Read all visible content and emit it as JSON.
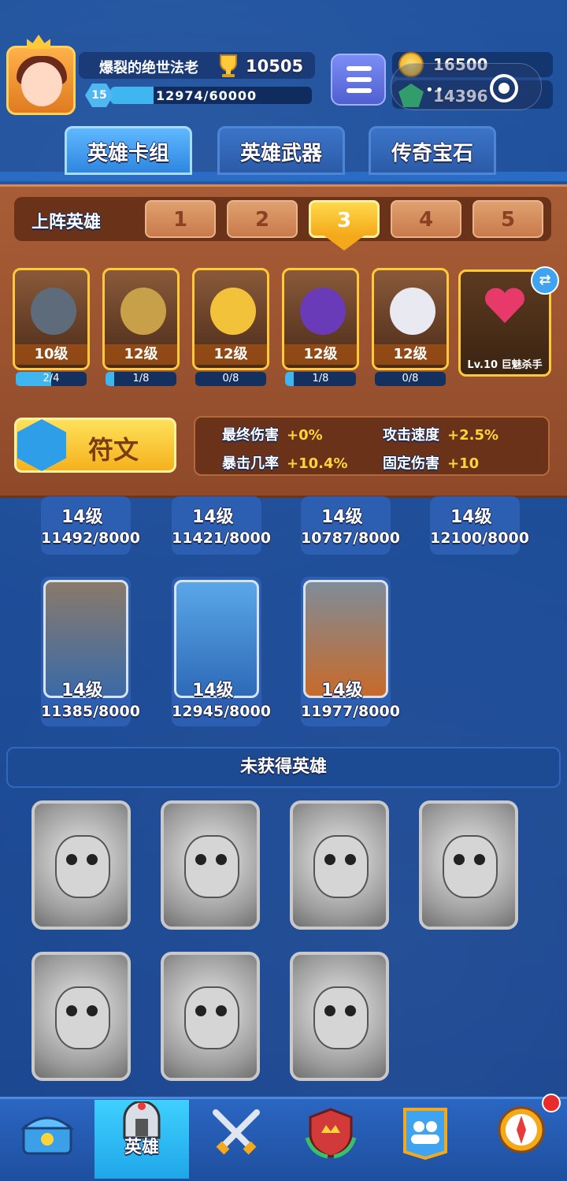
{
  "header": {
    "player_name": "爆裂的绝世法老",
    "trophies": "10505",
    "level": "15",
    "xp_text": "12974/60000",
    "xp_fraction": 0.216,
    "coins": "16500",
    "gems": "14396"
  },
  "tabs": [
    {
      "label": "英雄卡组",
      "active": true
    },
    {
      "label": "英雄武器",
      "active": false
    },
    {
      "label": "传奇宝石",
      "active": false
    }
  ],
  "deck": {
    "slots_label": "上阵英雄",
    "slots": [
      "1",
      "2",
      "3",
      "4",
      "5"
    ],
    "active_slot": "3",
    "heroes": [
      {
        "level": "10级",
        "progress": "2/4",
        "fraction": 0.5,
        "color": "#5d6b7a"
      },
      {
        "level": "12级",
        "progress": "1/8",
        "fraction": 0.125,
        "color": "#c9a04a"
      },
      {
        "level": "12级",
        "progress": "0/8",
        "fraction": 0,
        "color": "#f2c23a"
      },
      {
        "level": "12级",
        "progress": "1/8",
        "fraction": 0.125,
        "color": "#6a3bb8"
      },
      {
        "level": "12级",
        "progress": "0/8",
        "fraction": 0,
        "color": "#e9e9f2"
      }
    ],
    "special": {
      "label": "Lv.10 巨魅杀手"
    },
    "rune_label": "符文",
    "stats": [
      {
        "key": "最终伤害",
        "value": "+0%"
      },
      {
        "key": "攻击速度",
        "value": "+2.5%"
      },
      {
        "key": "暴击几率",
        "value": "+10.4%"
      },
      {
        "key": "固定伤害",
        "value": "+10"
      }
    ]
  },
  "owned": {
    "row1": [
      {
        "level": "14级",
        "count": "11492/8000"
      },
      {
        "level": "14级",
        "count": "11421/8000"
      },
      {
        "level": "14级",
        "count": "10787/8000"
      },
      {
        "level": "14级",
        "count": "12100/8000"
      }
    ],
    "row2": [
      {
        "level": "14级",
        "count": "11385/8000"
      },
      {
        "level": "14级",
        "count": "12945/8000"
      },
      {
        "level": "14级",
        "count": "11977/8000"
      }
    ]
  },
  "unowned": {
    "title": "未获得英雄",
    "count": 7
  },
  "nav": {
    "items": [
      "chest-icon",
      "hero-icon",
      "battle-icon",
      "rank-shield-icon",
      "guild-icon",
      "compass-icon"
    ],
    "active_label": "英雄"
  },
  "colors": {
    "accent": "#f4a91a",
    "panel": "#a85d36",
    "bg": "#1d4a93"
  }
}
